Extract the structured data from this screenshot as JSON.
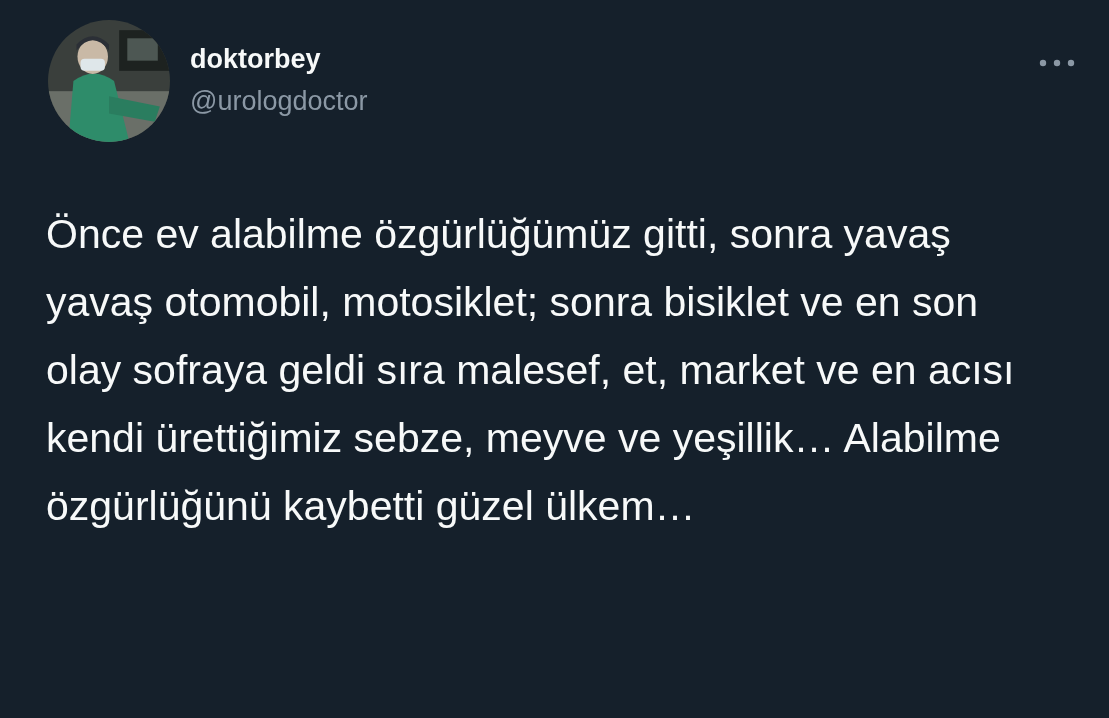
{
  "author": {
    "name": "doktorbey",
    "handle": "@urologdoctor"
  },
  "tweet": {
    "text": "Önce ev alabilme özgürlüğümüz gitti, sonra yavaş yavaş otomobil, motosiklet; sonra bisiklet ve en son olay sofraya geldi sıra malesef, et, market ve en acısı kendi ürettiğimiz sebze, meyve ve yeşillik… Alabilme özgürlüğünü kaybetti güzel ülkem…"
  }
}
